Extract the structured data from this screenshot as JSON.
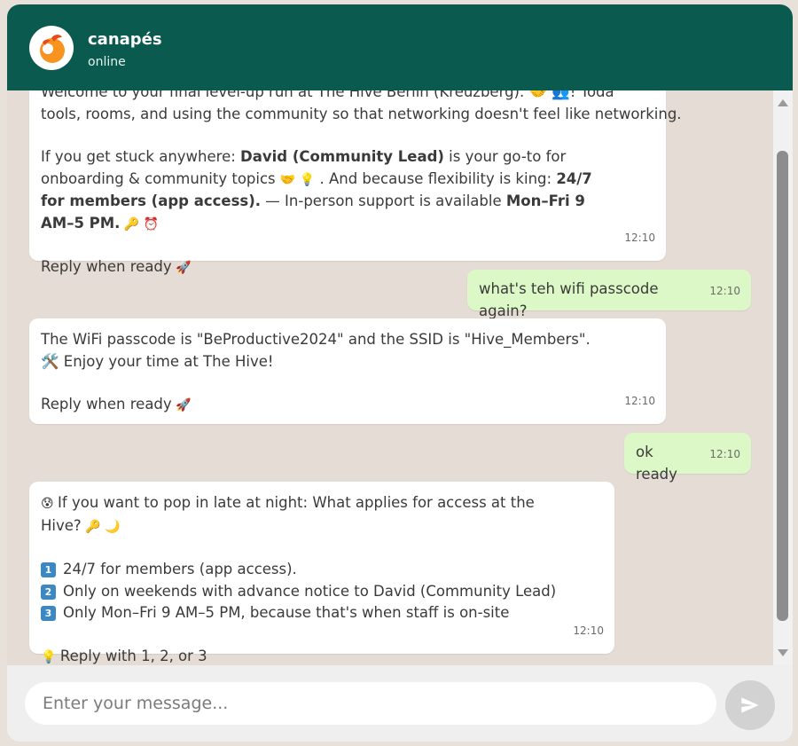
{
  "header": {
    "title": "canapés",
    "status": "online"
  },
  "messages": {
    "m1": {
      "cut_text": "Welcome to your final level-up run at The Hive Berlin (Kreuzberg). 🤝 👥! Today is about",
      "line2": "tools, rooms, and using the community so that networking doesn't feel like networking.",
      "p2_a": "If you get stuck anywhere: ",
      "p2_b": "David (Community Lead)",
      "p2_c": " is your go-to for onboarding & community topics ",
      "p2_e1": "🤝 💡",
      "p2_d": " . And because flexibility is king: ",
      "p2_f": "24/7 for members (app access).",
      "p2_g": " — In-person support is available ",
      "p2_h": "Mon–Fri 9 AM–5 PM.",
      "p2_e2": " 🔑 ⏰",
      "reply": "Reply when ready",
      "reply_emoji": " 🚀",
      "time": "12:10"
    },
    "m2": {
      "text": "what's teh wifi passcode again?",
      "time": "12:10"
    },
    "m3": {
      "text": "The WiFi passcode is \"BeProductive2024\" and the SSID is \"Hive_Members\". 🛠️ Enjoy your time at The Hive!",
      "reply": "Reply when ready",
      "reply_emoji": " 🚀",
      "time": "12:10"
    },
    "m4": {
      "text": "ok ready",
      "time": "12:10"
    },
    "m5": {
      "question_emoji": "😰 ",
      "question": "If you want to pop in late at night: What applies for access at the Hive?",
      "question_end": " 🔑 🌙",
      "opt1_num": "1",
      "opt1": "24/7 for members (app access).",
      "opt2_num": "2",
      "opt2": "Only on weekends with advance notice to David (Community Lead)",
      "opt3_num": "3",
      "opt3": "Only Mon–Fri 9 AM–5 PM, because that's when staff is on-site",
      "hint_emoji": "💡 ",
      "hint": "Reply with 1, 2, or 3",
      "time": "12:10"
    }
  },
  "composer": {
    "placeholder": "Enter your message..."
  },
  "icons": {
    "avatar": "canapes-logo",
    "send": "send-arrow-icon"
  },
  "colors": {
    "header": "#0a5a4f",
    "incoming": "#ffffff",
    "outgoing": "#dcf8c6",
    "background": "#e5ddd5"
  }
}
